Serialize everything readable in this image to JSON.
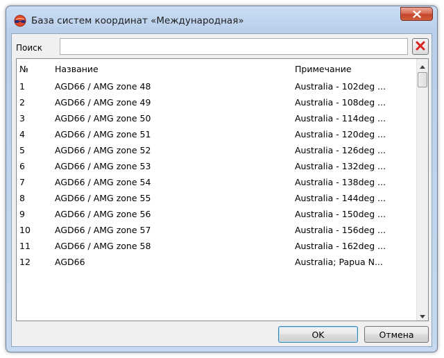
{
  "window": {
    "title": "База систем координат «Международная»",
    "icon": "globe-glasses-icon",
    "close_icon": "close-icon"
  },
  "search": {
    "label": "Поиск",
    "value": "",
    "placeholder": "",
    "clear_icon": "red-x-icon"
  },
  "table": {
    "columns": [
      "№",
      "Название",
      "Примечание"
    ],
    "rows": [
      {
        "num": "1",
        "name": "AGD66 / AMG zone 48",
        "note": "Australia - 102deg ..."
      },
      {
        "num": "2",
        "name": "AGD66 / AMG zone 49",
        "note": "Australia - 108deg ..."
      },
      {
        "num": "3",
        "name": "AGD66 / AMG zone 50",
        "note": "Australia - 114deg ..."
      },
      {
        "num": "4",
        "name": "AGD66 / AMG zone 51",
        "note": "Australia - 120deg ..."
      },
      {
        "num": "5",
        "name": "AGD66 / AMG zone 52",
        "note": "Australia - 126deg ..."
      },
      {
        "num": "6",
        "name": "AGD66 / AMG zone 53",
        "note": "Australia - 132deg ..."
      },
      {
        "num": "7",
        "name": "AGD66 / AMG zone 54",
        "note": "Australia - 138deg ..."
      },
      {
        "num": "8",
        "name": "AGD66 / AMG zone 55",
        "note": "Australia - 144deg ..."
      },
      {
        "num": "9",
        "name": "AGD66 / AMG zone 56",
        "note": "Australia - 150deg ..."
      },
      {
        "num": "10",
        "name": "AGD66 / AMG zone 57",
        "note": "Australia - 156deg ..."
      },
      {
        "num": "11",
        "name": "AGD66 / AMG zone 58",
        "note": "Australia - 162deg ..."
      },
      {
        "num": "12",
        "name": "AGD66",
        "note": "Australia; Papua N..."
      }
    ],
    "scroll_up_icon": "scroll-up-arrow-icon",
    "scroll_down_icon": "scroll-down-arrow-icon"
  },
  "buttons": {
    "ok_label": "OK",
    "cancel_label": "Отмена"
  },
  "colors": {
    "close_button": "#c4442a",
    "clear_x": "#d9221b",
    "default_button_border": "#3c7fb1"
  }
}
